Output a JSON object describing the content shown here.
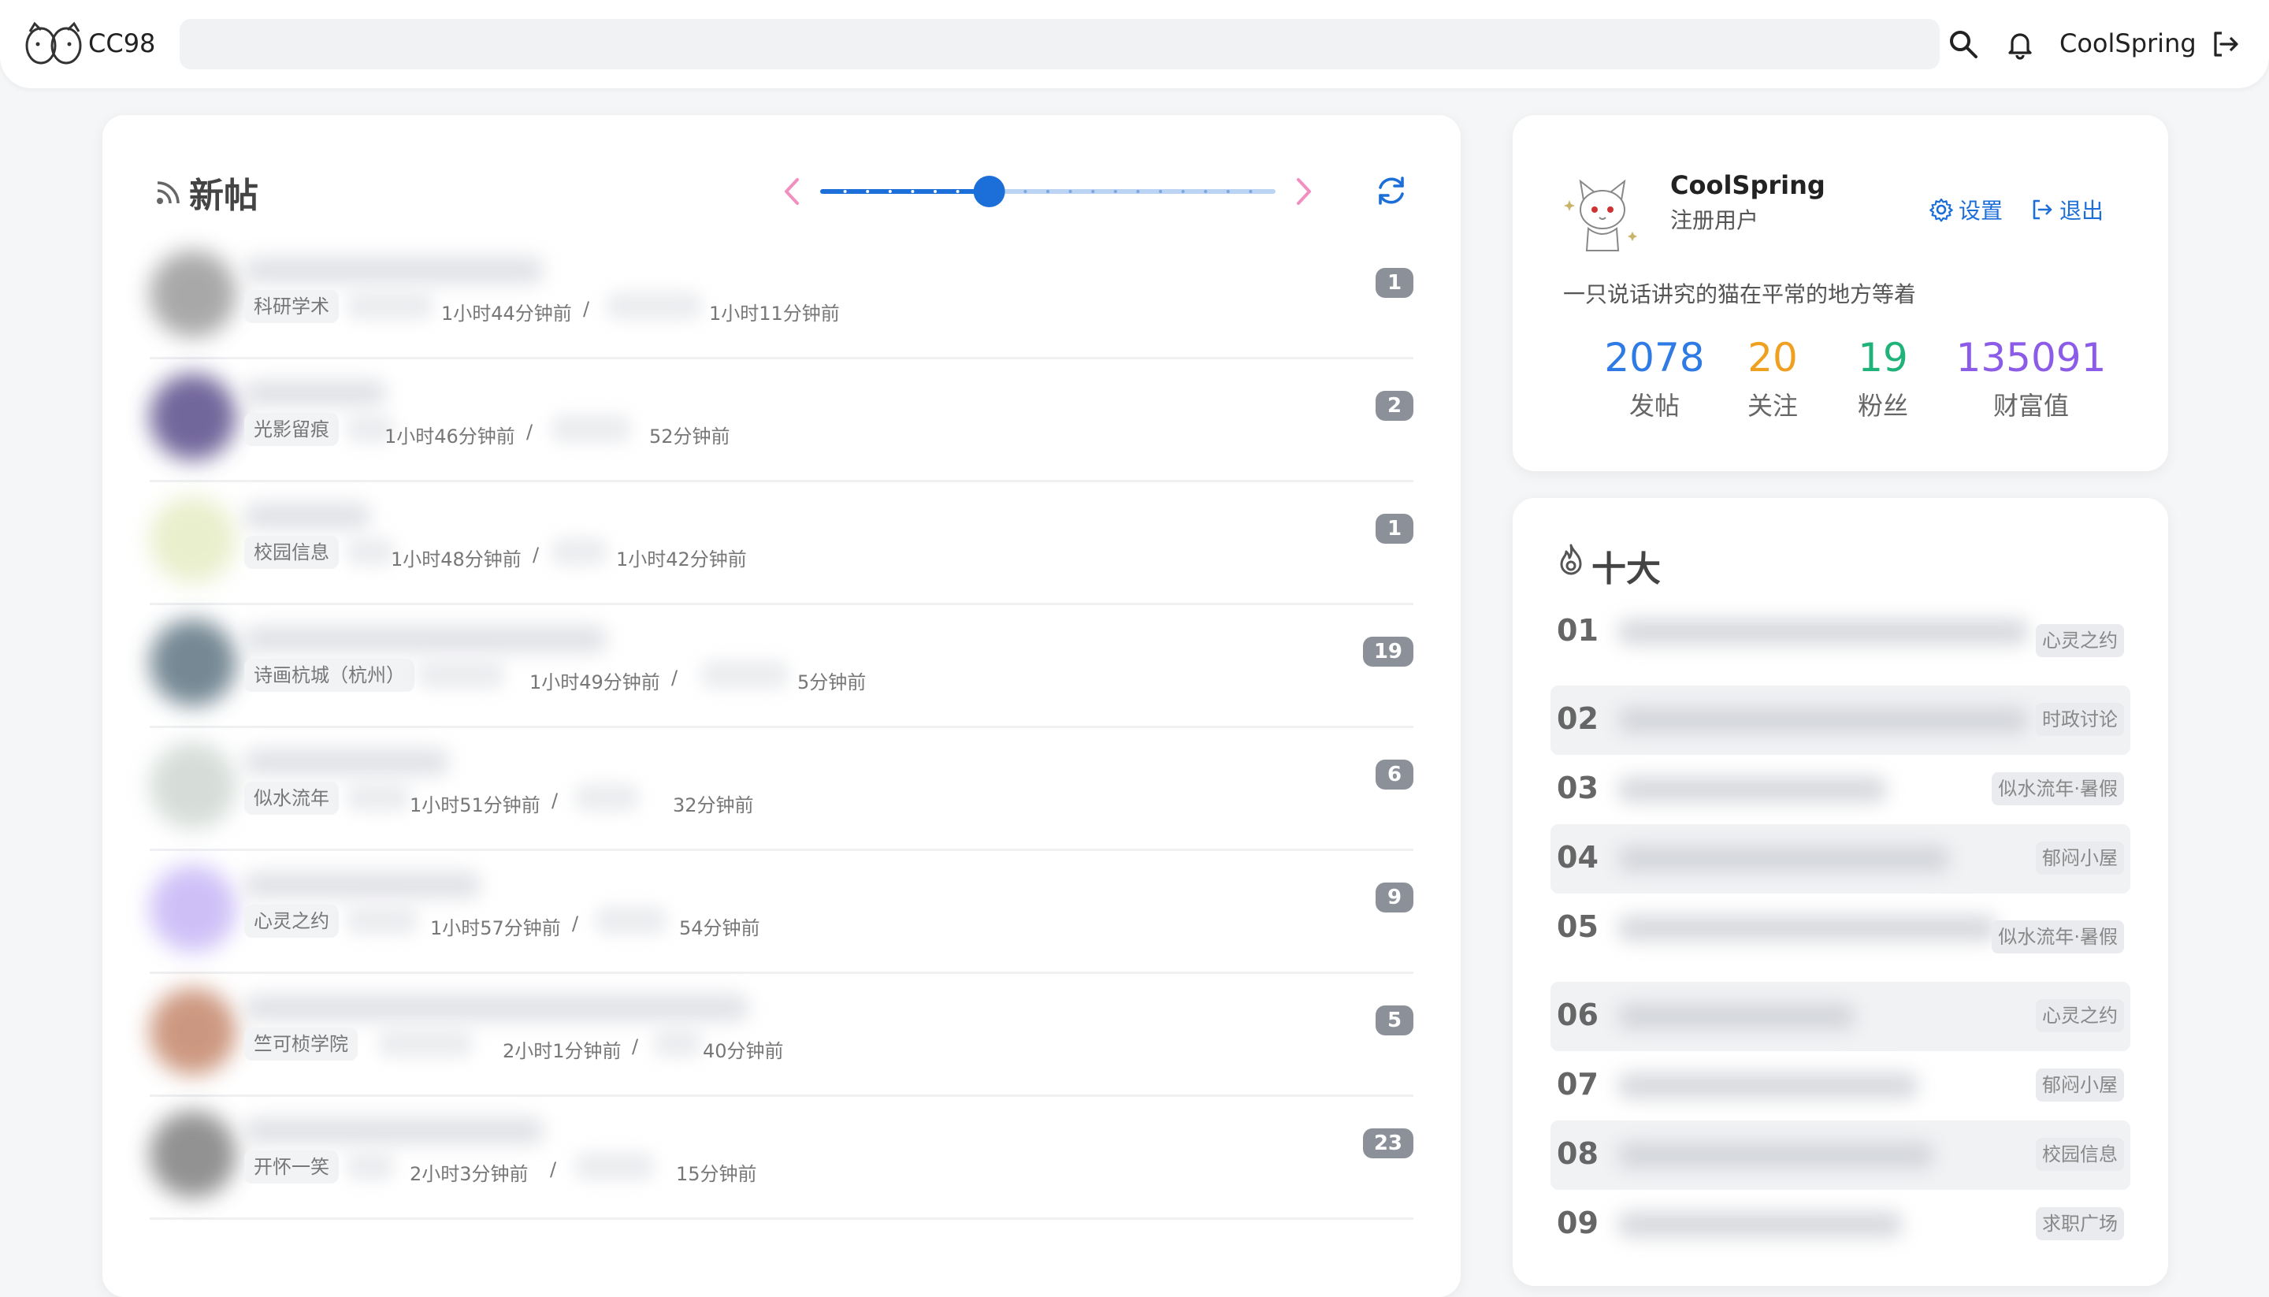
{
  "header": {
    "site_name": "CC98",
    "search_placeholder": "",
    "username": "CoolSpring"
  },
  "new_posts": {
    "title": "新帖",
    "slider_position": 0.37,
    "posts": [
      {
        "board": "科研学术",
        "created": "1小时44分钟前",
        "sep": "/",
        "last_reply": "1小时11分钟前",
        "replies": "1"
      },
      {
        "board": "光影留痕",
        "created": "1小时46分钟前",
        "sep": "/",
        "last_reply": "52分钟前",
        "replies": "2"
      },
      {
        "board": "校园信息",
        "created": "1小时48分钟前",
        "sep": "/",
        "last_reply": "1小时42分钟前",
        "replies": "1"
      },
      {
        "board": "诗画杭城（杭州）",
        "created": "1小时49分钟前",
        "sep": "/",
        "last_reply": "5分钟前",
        "replies": "19"
      },
      {
        "board": "似水流年",
        "created": "1小时51分钟前",
        "sep": "/",
        "last_reply": "32分钟前",
        "replies": "6"
      },
      {
        "board": "心灵之约",
        "created": "1小时57分钟前",
        "sep": "/",
        "last_reply": "54分钟前",
        "replies": "9"
      },
      {
        "board": "竺可桢学院",
        "created": "2小时1分钟前",
        "sep": "/",
        "last_reply": "40分钟前",
        "replies": "5"
      },
      {
        "board": "开怀一笑",
        "created": "2小时3分钟前",
        "sep": "/",
        "last_reply": "15分钟前",
        "replies": "23"
      }
    ]
  },
  "profile": {
    "name": "CoolSpring",
    "role": "注册用户",
    "settings_label": "设置",
    "logout_label": "退出",
    "signature": "一只说话讲究的猫在平常的地方等着",
    "stats": [
      {
        "value": "2078",
        "label": "发帖",
        "color": "#2f7be5"
      },
      {
        "value": "20",
        "label": "关注",
        "color": "#f0a020"
      },
      {
        "value": "19",
        "label": "粉丝",
        "color": "#1fb37a"
      },
      {
        "value": "135091",
        "label": "财富值",
        "color": "#8c5ce8"
      }
    ]
  },
  "hot_topics": {
    "title": "十大",
    "items": [
      {
        "rank": "01",
        "board": "心灵之约"
      },
      {
        "rank": "02",
        "board": "时政讨论"
      },
      {
        "rank": "03",
        "board": "似水流年·暑假"
      },
      {
        "rank": "04",
        "board": "郁闷小屋"
      },
      {
        "rank": "05",
        "board": "似水流年·暑假"
      },
      {
        "rank": "06",
        "board": "心灵之约"
      },
      {
        "rank": "07",
        "board": "郁闷小屋"
      },
      {
        "rank": "08",
        "board": "校园信息"
      },
      {
        "rank": "09",
        "board": "求职广场"
      }
    ]
  },
  "colors": {
    "accent": "#1c6fd8",
    "slider_arrows": "#f08fc0",
    "badge": "#8b9099"
  }
}
